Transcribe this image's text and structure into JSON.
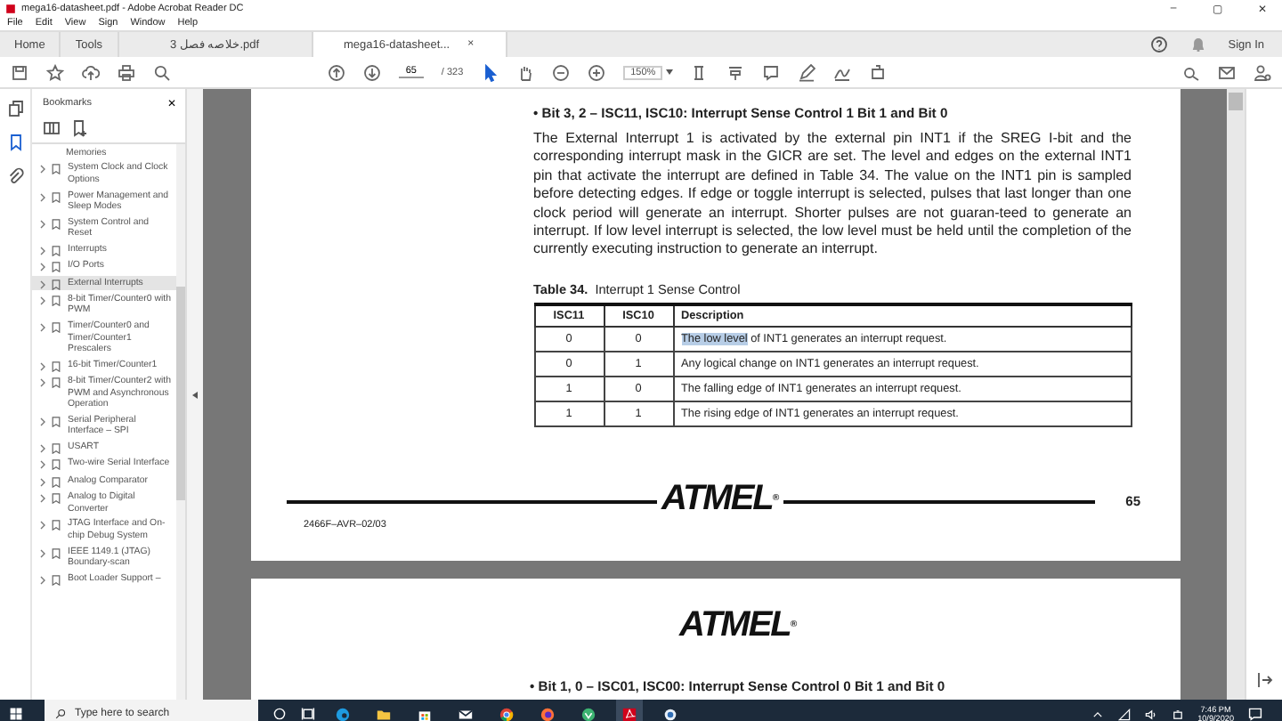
{
  "window": {
    "title": "mega16-datasheet.pdf - Adobe Acrobat Reader DC",
    "controls": [
      "–",
      "▢",
      "✕"
    ]
  },
  "menu": [
    "File",
    "Edit",
    "View",
    "Sign",
    "Window",
    "Help"
  ],
  "tabs": [
    {
      "label": "Home",
      "kind": "nav",
      "selected": false
    },
    {
      "label": "Tools",
      "kind": "nav",
      "selected": false
    },
    {
      "label": "خلاصه فصل 3.pdf",
      "kind": "doc",
      "selected": false
    },
    {
      "label": "mega16-datasheet...",
      "kind": "doc",
      "selected": true,
      "close": "×"
    }
  ],
  "sign_in": "Sign In",
  "toolbar": {
    "page": "65",
    "page_total": "/ 323",
    "zoom": "150%"
  },
  "bookmarks": {
    "title": "Bookmarks",
    "close": "✕",
    "items": [
      {
        "label": "Memories",
        "expandable": false,
        "selected": false
      },
      {
        "label": "System Clock and Clock Options",
        "expandable": true,
        "selected": false
      },
      {
        "label": "Power Management and Sleep Modes",
        "expandable": true,
        "selected": false
      },
      {
        "label": "System Control and Reset",
        "expandable": true,
        "selected": false
      },
      {
        "label": "Interrupts",
        "expandable": true,
        "selected": false
      },
      {
        "label": "I/O Ports",
        "expandable": true,
        "selected": false
      },
      {
        "label": "External Interrupts",
        "expandable": true,
        "selected": true
      },
      {
        "label": "8-bit Timer/Counter0 with PWM",
        "expandable": true,
        "selected": false
      },
      {
        "label": "Timer/Counter0 and Timer/Counter1 Prescalers",
        "expandable": true,
        "selected": false
      },
      {
        "label": "16-bit Timer/Counter1",
        "expandable": true,
        "selected": false
      },
      {
        "label": "8-bit Timer/Counter2 with PWM and Asynchronous Operation",
        "expandable": true,
        "selected": false
      },
      {
        "label": "Serial Peripheral Interface – SPI",
        "expandable": true,
        "selected": false
      },
      {
        "label": "USART",
        "expandable": true,
        "selected": false
      },
      {
        "label": "Two-wire Serial Interface",
        "expandable": true,
        "selected": false
      },
      {
        "label": "Analog Comparator",
        "expandable": true,
        "selected": false
      },
      {
        "label": "Analog to Digital Converter",
        "expandable": true,
        "selected": false
      },
      {
        "label": "JTAG Interface and On-chip Debug System",
        "expandable": true,
        "selected": false
      },
      {
        "label": "IEEE 1149.1 (JTAG) Boundary-scan",
        "expandable": true,
        "selected": false
      },
      {
        "label": "Boot Loader Support –",
        "expandable": true,
        "selected": false
      }
    ]
  },
  "page": {
    "bullet": "•",
    "heading": "Bit 3, 2 – ISC11, ISC10: Interrupt Sense Control 1 Bit 1 and Bit 0",
    "paragraph": "The External Interrupt 1 is activated by the external pin INT1 if the SREG I-bit and the corresponding interrupt mask in the GICR are set. The level and edges on the external INT1 pin that activate the interrupt are defined in Table 34. The value on the INT1 pin is sampled before detecting edges. If edge or toggle interrupt is selected, pulses that last longer than one clock period will generate an interrupt. Shorter pulses are not guaran-teed to generate an interrupt. If low level interrupt is selected, the low level must be held until the completion of the currently executing instruction to generate an interrupt.",
    "table_label": "Table 34.",
    "table_title": "Interrupt 1 Sense Control",
    "table": {
      "columns": [
        "ISC11",
        "ISC10",
        "Description"
      ],
      "rows": [
        {
          "isc11": "0",
          "isc10": "0",
          "description": [
            {
              "text": "The low level",
              "selected": true
            },
            {
              "text": "of INT1 generates an interrupt request.",
              "selected": false
            }
          ]
        },
        {
          "isc11": "0",
          "isc10": "1",
          "description": [
            {
              "text": "Any logical change on INT1 generates an interrupt request.",
              "selected": false
            }
          ]
        },
        {
          "isc11": "1",
          "isc10": "0",
          "description": [
            {
              "text": "The falling edge of INT1 generates an interrupt request.",
              "selected": false
            }
          ]
        },
        {
          "isc11": "1",
          "isc10": "1",
          "description": [
            {
              "text": "The rising edge of INT1 generates an interrupt request.",
              "selected": false
            }
          ]
        }
      ]
    },
    "logo": "ATMEL",
    "registered": "®",
    "footer_code": "2466F–AVR–02/03",
    "page_number": "65"
  },
  "next_page": {
    "logo": "ATMEL",
    "registered": "®",
    "bullet": "•",
    "heading": "Bit 1, 0 – ISC01, ISC00: Interrupt Sense Control 0 Bit 1 and Bit 0"
  },
  "taskbar": {
    "search": "Type here to search",
    "time": "7:46 PM",
    "date": "10/9/2020"
  }
}
